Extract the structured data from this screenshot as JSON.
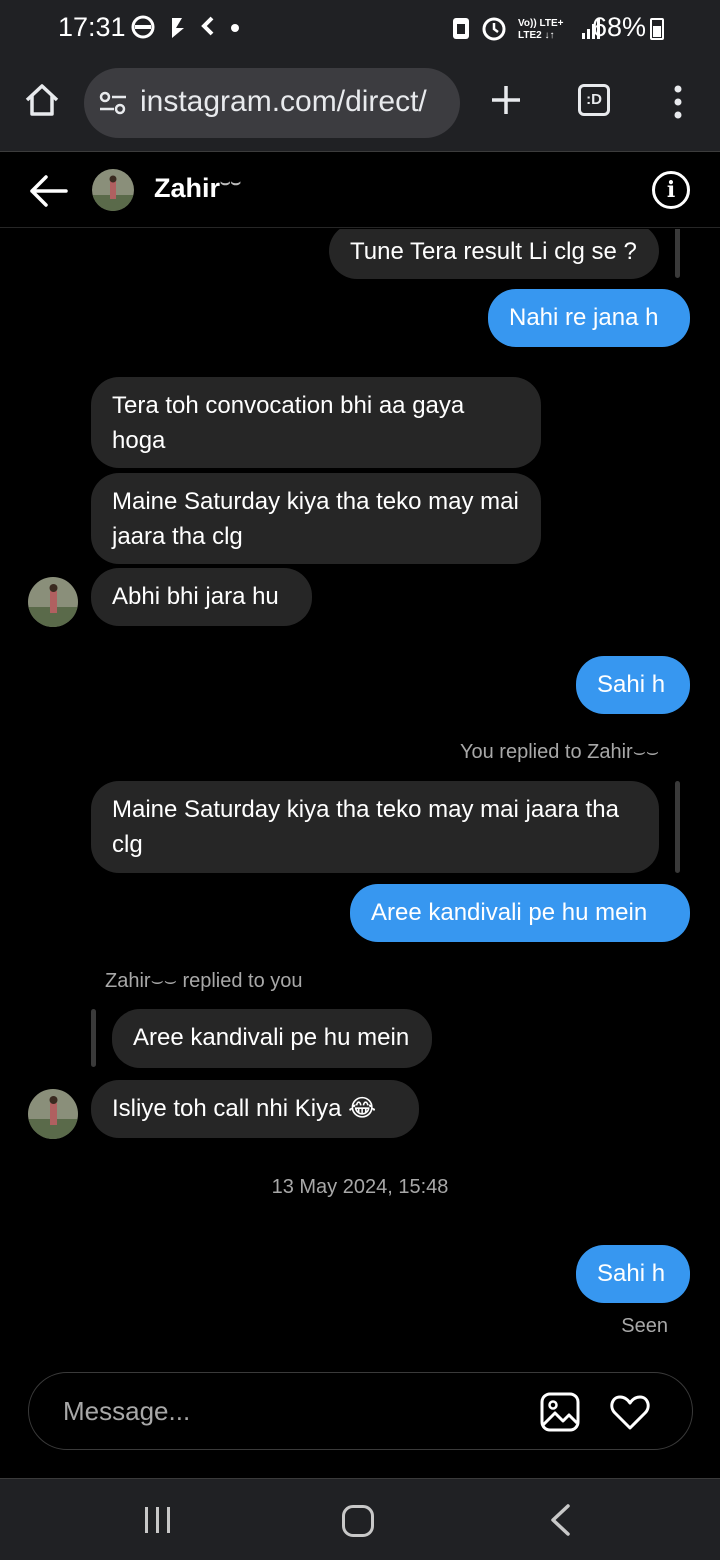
{
  "status_bar": {
    "time": "17:31",
    "battery": "68%",
    "network": "Vo)) LTE+ LTE2"
  },
  "browser": {
    "url": "instagram.com/direct/"
  },
  "header": {
    "name": "Zahir",
    "name_suffix": "⌣⌣"
  },
  "messages": {
    "m1": "Tune Tera result Li clg se ?",
    "m2": "Nahi re jana h",
    "m3": "Tera toh convocation bhi aa gaya hoga",
    "m4": "Maine Saturday kiya tha teko may mai jaara tha clg",
    "m5": "Abhi bhi jara hu",
    "m6": "Sahi h",
    "reply_label_out": "You replied to Zahir⌣⌣",
    "m7_quote": "Maine Saturday kiya tha teko may mai jaara tha clg",
    "m8": "Aree kandivali pe hu mein",
    "reply_label_in": "Zahir⌣⌣ replied to you",
    "m9_quote": "Aree kandivali pe hu mein",
    "m10": "Isliye toh call nhi Kiya 😂",
    "timestamp": "13 May 2024, 15:48",
    "m11": "Sahi h",
    "seen": "Seen"
  },
  "composer": {
    "placeholder": "Message..."
  },
  "colors": {
    "outgoing_bubble": "#3797f0",
    "incoming_bubble": "#262626",
    "background": "#000000"
  }
}
